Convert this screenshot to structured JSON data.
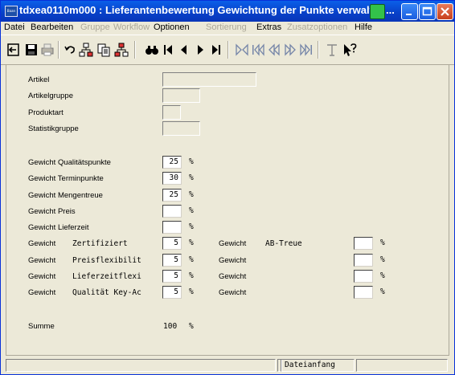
{
  "window": {
    "title": "tdxea0110m000 : Lieferantenbewertung Gewichtung der Punkte verwalt",
    "title_ellipsis": "..."
  },
  "menu": [
    {
      "label": "Datei",
      "enabled": true
    },
    {
      "label": "Bearbeiten",
      "enabled": true
    },
    {
      "label": "Gruppe",
      "enabled": false
    },
    {
      "label": "Workflow",
      "enabled": false
    },
    {
      "label": "Optionen",
      "enabled": true
    },
    {
      "label": "Sortierung",
      "enabled": false
    },
    {
      "label": "Extras",
      "enabled": true
    },
    {
      "label": "Zusatzoptionen",
      "enabled": false
    },
    {
      "label": "Hilfe",
      "enabled": true
    }
  ],
  "toolbar_icons": [
    "exit-icon",
    "save-icon",
    "print-icon",
    "undo-icon",
    "tree-icon",
    "copy-icon",
    "tree-export-icon",
    "find-icon",
    "first-record-icon",
    "previous-record-icon",
    "next-record-icon",
    "last-record-icon",
    "first-set-icon",
    "previous-set-icon",
    "rewind-icon",
    "fast-forward-icon",
    "last-set-icon",
    "text-icon",
    "help-icon"
  ],
  "form": {
    "artikel_label": "Artikel",
    "artikelgruppe_label": "Artikelgruppe",
    "produktart_label": "Produktart",
    "statistikgruppe_label": "Statistikgruppe",
    "gewicht_qualitaet_label": "Gewicht Qualitätspunkte",
    "gewicht_qualitaet_value": "25",
    "gewicht_termin_label": "Gewicht Terminpunkte",
    "gewicht_termin_value": "30",
    "gewicht_mengen_label": "Gewicht Mengentreue",
    "gewicht_mengen_value": "25",
    "gewicht_preis_label": "Gewicht Preis",
    "gewicht_preis_value": "",
    "gewicht_lieferzeit_label": "Gewicht Lieferzeit",
    "gewicht_lieferzeit_value": "",
    "percent_sign": "%",
    "gewicht_label": "Gewicht",
    "extra_rows": [
      {
        "left_name": "Zertifiziert",
        "left_value": "5",
        "right_name": "AB-Treue",
        "right_value": ""
      },
      {
        "left_name": "Preisflexibilit",
        "left_value": "5",
        "right_name": "",
        "right_value": ""
      },
      {
        "left_name": "Lieferzeitflexi",
        "left_value": "5",
        "right_name": "",
        "right_value": ""
      },
      {
        "left_name": "Qualität Key-Ac",
        "left_value": "5",
        "right_name": "",
        "right_value": ""
      }
    ],
    "summe_label": "Summe",
    "summe_value": "100"
  },
  "status": {
    "panel1": "",
    "panel2": "",
    "panel3": "Dateianfang",
    "panel4": ""
  },
  "colors": {
    "titlebar": "#0a5fe8",
    "window_bg": "#ece9d8",
    "close_button": "#c8401c"
  }
}
